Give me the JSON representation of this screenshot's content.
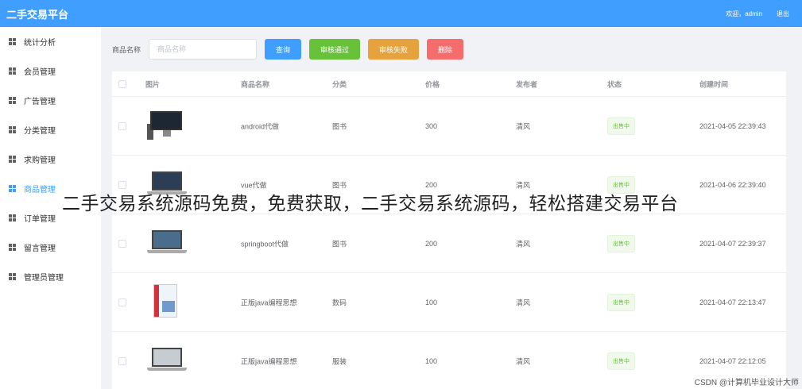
{
  "header": {
    "app_title": "二手交易平台",
    "welcome_text": "欢迎，admin",
    "logout_label": "退出"
  },
  "sidebar": {
    "items": [
      {
        "label": "统计分析",
        "active": false
      },
      {
        "label": "会员管理",
        "active": false
      },
      {
        "label": "广告管理",
        "active": false
      },
      {
        "label": "分类管理",
        "active": false
      },
      {
        "label": "求购管理",
        "active": false
      },
      {
        "label": "商品管理",
        "active": true
      },
      {
        "label": "订单管理",
        "active": false
      },
      {
        "label": "留言管理",
        "active": false
      },
      {
        "label": "管理员管理",
        "active": false
      }
    ]
  },
  "toolbar": {
    "search_label": "商品名称",
    "search_placeholder": "商品名称",
    "query_label": "查询",
    "approve_label": "审核通过",
    "reject_label": "审核失败",
    "delete_label": "删除"
  },
  "table": {
    "columns": [
      "图片",
      "商品名称",
      "分类",
      "价格",
      "发布者",
      "状态",
      "创建时间"
    ],
    "rows": [
      {
        "name": "android代做",
        "category": "图书",
        "price": "300",
        "publisher": "清风",
        "status": "出售中",
        "created": "2021-04-05 22:39:43",
        "thumb": "desktop"
      },
      {
        "name": "vue代做",
        "category": "图书",
        "price": "200",
        "publisher": "清风",
        "status": "出售中",
        "created": "2021-04-06 22:39:40",
        "thumb": "laptop"
      },
      {
        "name": "springboot代做",
        "category": "图书",
        "price": "200",
        "publisher": "清风",
        "status": "出售中",
        "created": "2021-04-07 22:39:37",
        "thumb": "laptop"
      },
      {
        "name": "正版java编程思想",
        "category": "数码",
        "price": "100",
        "publisher": "清风",
        "status": "出售中",
        "created": "2021-04-07 22:13:47",
        "thumb": "book"
      },
      {
        "name": "正版java编程思想",
        "category": "服装",
        "price": "100",
        "publisher": "清风",
        "status": "出售中",
        "created": "2021-04-07 22:12:05",
        "thumb": "laptop"
      }
    ]
  },
  "overlay_text": "二手交易系统源码免费，免费获取，二手交易系统源码，轻松搭建交易平台",
  "watermark": "CSDN @计算机毕业设计大师",
  "colors": {
    "primary": "#409eff",
    "success": "#67c23a",
    "warning": "#e6a23c",
    "danger": "#f56c6c"
  }
}
